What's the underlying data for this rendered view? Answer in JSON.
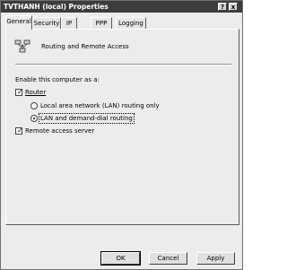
{
  "window": {
    "title": "TVTHANH (local) Properties",
    "help_button": "?",
    "close_button": "x"
  },
  "tabs": [
    {
      "label": "General",
      "active": true
    },
    {
      "label": "Security",
      "active": false
    },
    {
      "label": "IP",
      "active": false
    },
    {
      "label": "PPP",
      "active": false
    },
    {
      "label": "Logging",
      "active": false
    }
  ],
  "general": {
    "header_label": "Routing and Remote Access",
    "header_icon": "routing-remote-access-icon",
    "enable_label": "Enable this computer as a:",
    "router": {
      "label": "Router",
      "checked": true
    },
    "lan_only": {
      "label": "Local area network (LAN) routing only",
      "selected": false
    },
    "lan_demand_dial": {
      "label": "LAN and demand-dial routing",
      "selected": true
    },
    "remote_access_server": {
      "label": "Remote access server",
      "checked": true
    }
  },
  "buttons": {
    "ok": "OK",
    "cancel": "Cancel",
    "apply": "Apply"
  }
}
